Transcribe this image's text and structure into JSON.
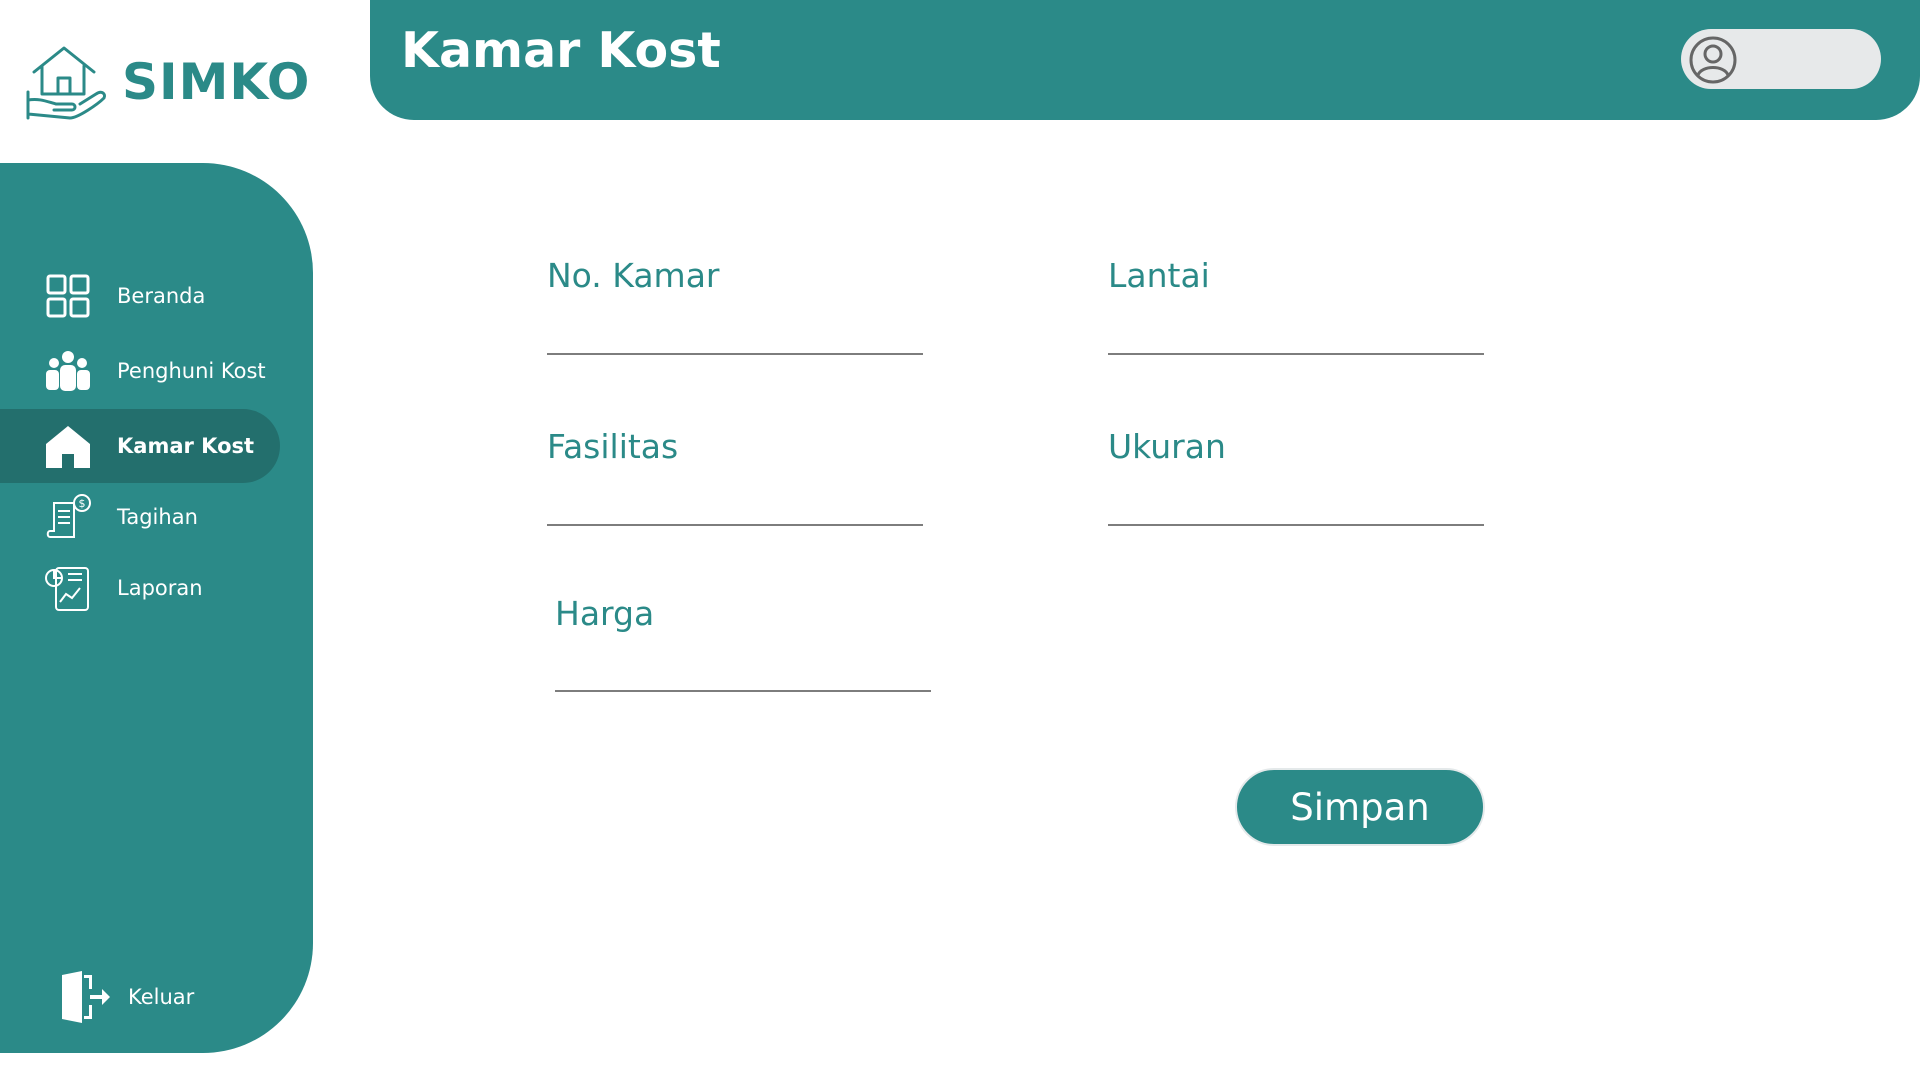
{
  "brand": {
    "name": "SIMKO",
    "logo_icon": "house-in-hand-icon",
    "color": "#2b8a88"
  },
  "header": {
    "title": "Kamar Kost",
    "user_icon": "user-avatar-icon"
  },
  "sidebar": {
    "items": [
      {
        "label": "Beranda",
        "icon": "dashboard-grid-icon",
        "active": false
      },
      {
        "label": "Penghuni Kost",
        "icon": "people-group-icon",
        "active": false
      },
      {
        "label": "Kamar Kost",
        "icon": "home-icon",
        "active": true
      },
      {
        "label": "Tagihan",
        "icon": "bill-receipt-icon",
        "active": false
      },
      {
        "label": "Laporan",
        "icon": "report-chart-icon",
        "active": false
      }
    ],
    "logout": {
      "label": "Keluar",
      "icon": "logout-door-icon"
    }
  },
  "form": {
    "no_kamar": {
      "label": "No. Kamar",
      "value": ""
    },
    "lantai": {
      "label": "Lantai",
      "value": ""
    },
    "fasilitas": {
      "label": "Fasilitas",
      "value": ""
    },
    "ukuran": {
      "label": "Ukuran",
      "value": ""
    },
    "harga": {
      "label": "Harga",
      "value": ""
    },
    "submit_label": "Simpan"
  },
  "colors": {
    "primary": "#2b8a88",
    "primary_dark": "#236f6d",
    "pill": "#e7e9ea"
  }
}
